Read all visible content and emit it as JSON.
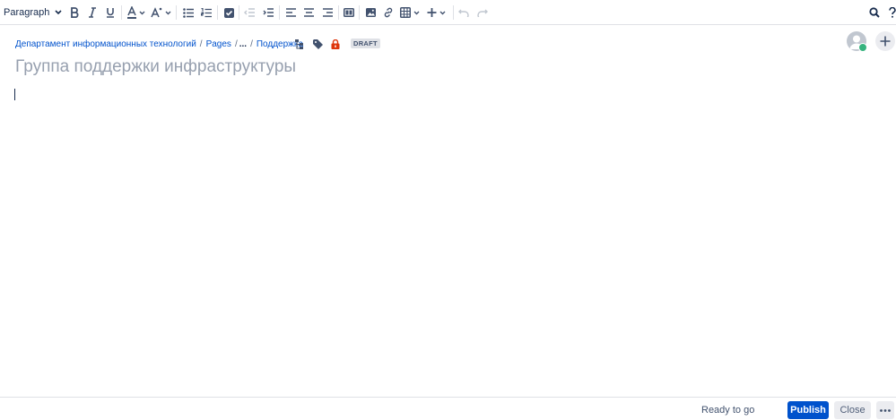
{
  "toolbar": {
    "text_style": "Paragraph",
    "icons": [
      "bold-icon",
      "italic-icon",
      "underline-icon",
      "text-color-icon",
      "text-formatting-icon",
      "bullet-list-icon",
      "numbered-list-icon",
      "checkbox-icon",
      "outdent-icon",
      "indent-icon",
      "align-left-icon",
      "align-center-icon",
      "align-right-icon",
      "layout-icon",
      "image-icon",
      "link-icon",
      "table-icon",
      "insert-icon",
      "undo-icon",
      "redo-icon",
      "search-icon",
      "help-icon"
    ]
  },
  "breadcrumb": {
    "items": [
      "Департамент информационных технологий",
      "Pages",
      "...",
      "Поддержка"
    ],
    "separator": "/"
  },
  "status_badge": "DRAFT",
  "page": {
    "title_placeholder": "Группа поддержки инфраструктуры"
  },
  "footer": {
    "status": "Ready to go",
    "publish_label": "Publish",
    "close_label": "Close"
  },
  "colors": {
    "primary": "#0052cc",
    "text": "#172b4d",
    "icon": "#42526e",
    "placeholder": "#97a0af",
    "restriction": "#de350b",
    "presence": "#36b37e"
  }
}
